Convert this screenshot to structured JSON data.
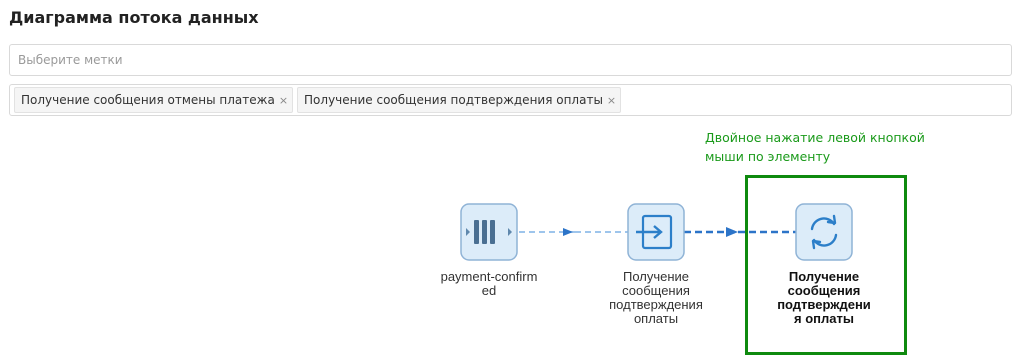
{
  "page": {
    "title": "Диаграмма потока данных"
  },
  "tag_select": {
    "placeholder": "Выберите метки"
  },
  "selected_tags": [
    {
      "label": "Получение сообщения отмены платежа",
      "remove": "×"
    },
    {
      "label": "Получение сообщения подтверждения оплаты",
      "remove": "×"
    }
  ],
  "hint": {
    "line1": "Двойное нажатие левой кнопкой",
    "line2": "мыши по элементу",
    "color": "#1a9a1a"
  },
  "diagram": {
    "nodes": [
      {
        "icon": "queue-icon",
        "label_line1": "payment-confirm",
        "label_line2": "ed"
      },
      {
        "icon": "receive-message-icon",
        "label_line1": "Получение",
        "label_line2": "сообщения",
        "label_line3": "подтверждения",
        "label_line4": "оплаты"
      },
      {
        "icon": "refresh-icon",
        "label_line1": "Получение",
        "label_line2": "сообщения",
        "label_line3": "подтверждени",
        "label_line4": "я оплаты"
      }
    ],
    "colors": {
      "node_fill": "#dcecf9",
      "node_border": "#8fb3d6",
      "icon": "#2c7fc9",
      "edge_light": "#7fb2e5",
      "edge_dark": "#2c74c8",
      "highlight": "#0f8a0f"
    }
  }
}
